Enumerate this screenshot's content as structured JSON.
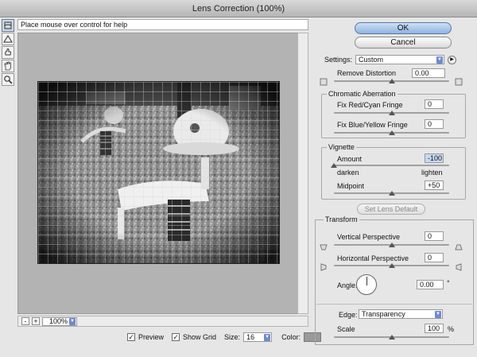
{
  "window": {
    "title": "Lens Correction (100%)"
  },
  "help_text": "Place mouse over control for help",
  "tools": [
    "remove-distortion-tool-icon",
    "straighten-tool-icon",
    "move-grid-tool-icon",
    "hand-tool-icon",
    "zoom-tool-icon"
  ],
  "buttons": {
    "ok": "OK",
    "cancel": "Cancel",
    "set_lens_default": "Set Lens Default"
  },
  "settings": {
    "label": "Settings:",
    "value": "Custom"
  },
  "remove_distortion": {
    "label": "Remove Distortion",
    "value": "0.00",
    "level": 0.5
  },
  "chromatic": {
    "title": "Chromatic Aberration",
    "red_cyan": {
      "label": "Fix Red/Cyan Fringe",
      "value": "0",
      "level": 0.5
    },
    "blue_yellow": {
      "label": "Fix Blue/Yellow Fringe",
      "value": "0",
      "level": 0.5
    }
  },
  "vignette": {
    "title": "Vignette",
    "amount": {
      "label": "Amount",
      "value": "-100",
      "level": 0.0
    },
    "darken": "darken",
    "lighten": "lighten",
    "midpoint": {
      "label": "Midpoint",
      "value": "+50",
      "level": 0.5
    }
  },
  "transform": {
    "title": "Transform",
    "vertical": {
      "label": "Vertical Perspective",
      "value": "0",
      "level": 0.5
    },
    "horizontal": {
      "label": "Horizontal Perspective",
      "value": "0",
      "level": 0.5
    },
    "angle": {
      "label": "Angle:",
      "value": "0.00",
      "unit": "°"
    },
    "edge": {
      "label": "Edge:",
      "value": "Transparency"
    },
    "scale": {
      "label": "Scale",
      "value": "100",
      "unit": "%",
      "level": 0.5
    }
  },
  "zoom": {
    "minus": "-",
    "plus": "+",
    "value": "100%"
  },
  "bottom": {
    "preview": {
      "label": "Preview",
      "checked": true
    },
    "show_grid": {
      "label": "Show Grid",
      "checked": true
    },
    "size": {
      "label": "Size:",
      "value": "16"
    },
    "color": {
      "label": "Color:",
      "swatch": "#9a9a9a"
    }
  },
  "colors": {
    "accent": "#8fb3e0",
    "highlight": "#c8d9f2"
  }
}
